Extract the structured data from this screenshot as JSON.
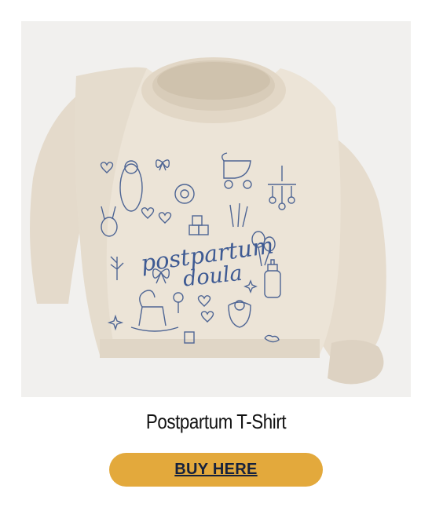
{
  "product": {
    "image_alt": "Cream sweatshirt with postpartum doula illustrations",
    "print_text_line1": "postpartum",
    "print_text_line2": "doula",
    "title": "Postpartum T-Shirt"
  },
  "cta": {
    "label": "BUY HERE"
  },
  "colors": {
    "button": "#e3a93c",
    "button_text": "#15213d",
    "sweatshirt": "#ebe3d6",
    "print": "#4e6594"
  }
}
